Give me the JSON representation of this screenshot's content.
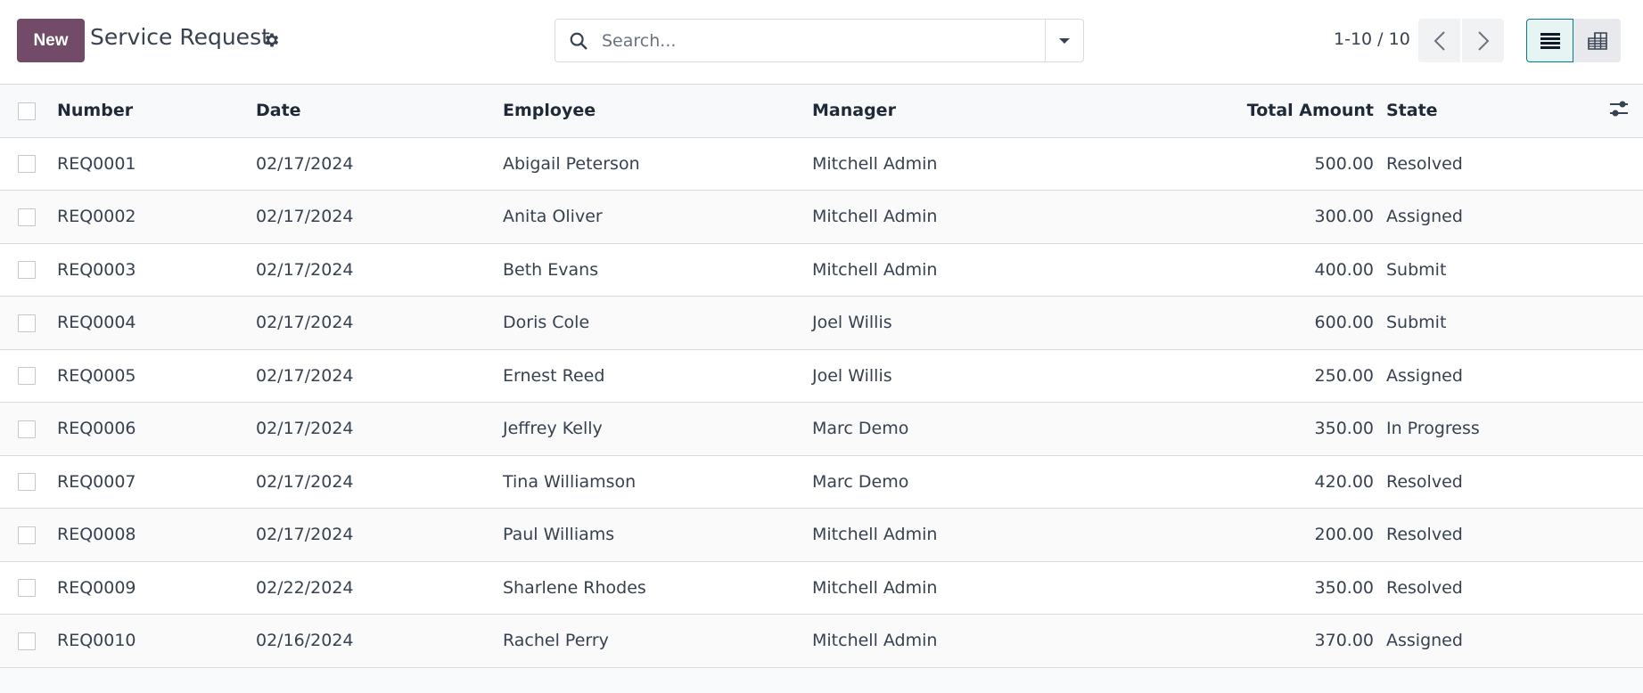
{
  "control_panel": {
    "new_button_label": "New",
    "title": "Service Request",
    "actions_icon": "gear-icon",
    "search": {
      "placeholder": "Search...",
      "value": "",
      "icon": "search-icon",
      "toggle_icon": "caret-down-icon"
    },
    "pager": {
      "value": "1-10 / 10",
      "prev_icon": "chevron-left-icon",
      "next_icon": "chevron-right-icon"
    },
    "views": [
      {
        "name": "list",
        "icon": "list-icon",
        "active": true
      },
      {
        "name": "pivot",
        "icon": "pivot-table-icon",
        "active": false
      }
    ],
    "colors": {
      "primary": "#714b67",
      "active_view_border": "#017e84",
      "active_view_bg": "#e6f4f4"
    }
  },
  "table": {
    "columns": [
      "Number",
      "Date",
      "Employee",
      "Manager",
      "Total Amount",
      "State"
    ],
    "optional_columns_icon": "sliders-icon",
    "rows": [
      {
        "number": "REQ0001",
        "date": "02/17/2024",
        "employee": "Abigail Peterson",
        "manager": "Mitchell Admin",
        "total": "500.00",
        "state": "Resolved"
      },
      {
        "number": "REQ0002",
        "date": "02/17/2024",
        "employee": "Anita Oliver",
        "manager": "Mitchell Admin",
        "total": "300.00",
        "state": "Assigned"
      },
      {
        "number": "REQ0003",
        "date": "02/17/2024",
        "employee": "Beth Evans",
        "manager": "Mitchell Admin",
        "total": "400.00",
        "state": "Submit"
      },
      {
        "number": "REQ0004",
        "date": "02/17/2024",
        "employee": "Doris Cole",
        "manager": "Joel Willis",
        "total": "600.00",
        "state": "Submit"
      },
      {
        "number": "REQ0005",
        "date": "02/17/2024",
        "employee": "Ernest Reed",
        "manager": "Joel Willis",
        "total": "250.00",
        "state": "Assigned"
      },
      {
        "number": "REQ0006",
        "date": "02/17/2024",
        "employee": "Jeffrey Kelly",
        "manager": "Marc Demo",
        "total": "350.00",
        "state": "In Progress"
      },
      {
        "number": "REQ0007",
        "date": "02/17/2024",
        "employee": "Tina Williamson",
        "manager": "Marc Demo",
        "total": "420.00",
        "state": "Resolved"
      },
      {
        "number": "REQ0008",
        "date": "02/17/2024",
        "employee": "Paul Williams",
        "manager": "Mitchell Admin",
        "total": "200.00",
        "state": "Resolved"
      },
      {
        "number": "REQ0009",
        "date": "02/22/2024",
        "employee": "Sharlene Rhodes",
        "manager": "Mitchell Admin",
        "total": "350.00",
        "state": "Resolved"
      },
      {
        "number": "REQ0010",
        "date": "02/16/2024",
        "employee": "Rachel Perry",
        "manager": "Mitchell Admin",
        "total": "370.00",
        "state": "Assigned"
      }
    ]
  }
}
